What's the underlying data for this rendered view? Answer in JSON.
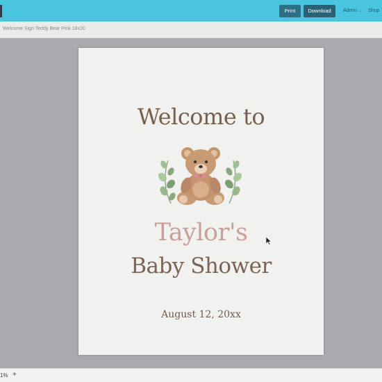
{
  "topbar": {
    "print_label": "Print",
    "download_label": "Download",
    "admin_label": "Admin",
    "shop_label": "Shop",
    "accent_color": "#49c5e0"
  },
  "document": {
    "title": "Welcome Sign Teddy Bear Pink 18x20"
  },
  "sign": {
    "line1": "Welcome to",
    "name": "Taylor's",
    "event": "Baby Shower",
    "date": "August 12, 20xx",
    "illustration": "teddy-bear-with-eucalyptus"
  },
  "zoom": {
    "value": "1%",
    "plus": "+"
  }
}
